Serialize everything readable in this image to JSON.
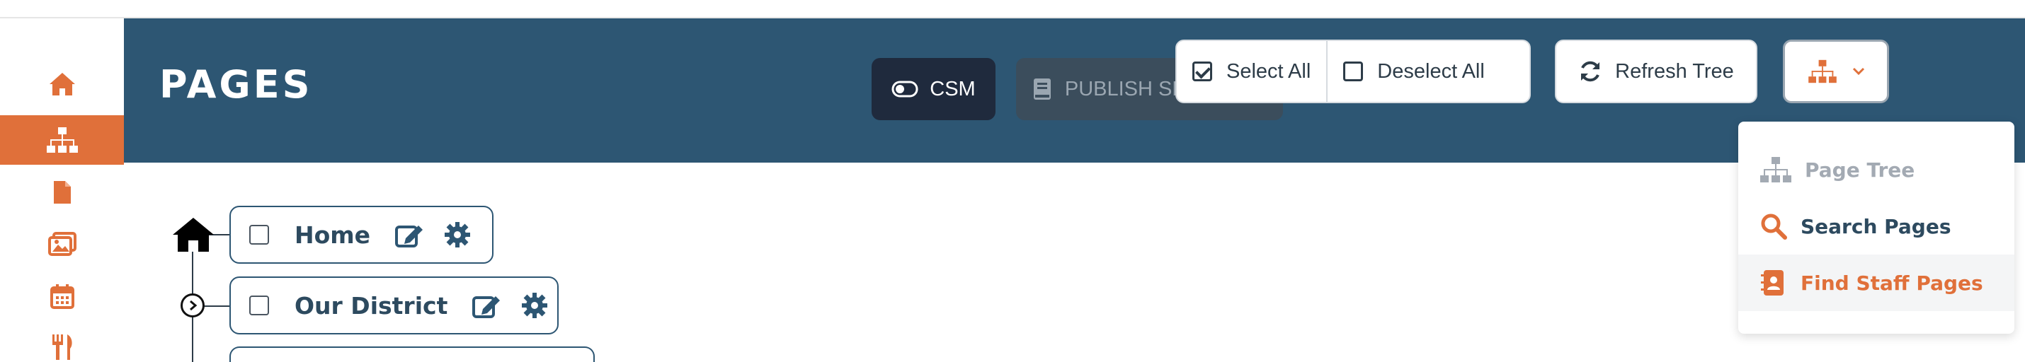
{
  "header": {
    "title": "PAGES"
  },
  "sidebar": {
    "items": [
      {
        "icon": "home-icon",
        "active": false
      },
      {
        "icon": "sitemap-icon",
        "active": true
      },
      {
        "icon": "file-icon",
        "active": false
      },
      {
        "icon": "images-icon",
        "active": false
      },
      {
        "icon": "calendar-icon",
        "active": false
      },
      {
        "icon": "utensils-icon",
        "active": false
      }
    ]
  },
  "toolbar": {
    "csm_label": "CSM",
    "publish_label": "PUBLISH SELECTED",
    "select_all_label": "Select All",
    "deselect_all_label": "Deselect All",
    "refresh_label": "Refresh Tree"
  },
  "dropdown": {
    "items": [
      {
        "label": "Page Tree",
        "icon": "sitemap-icon",
        "state": "disabled"
      },
      {
        "label": "Search Pages",
        "icon": "search-icon",
        "state": "normal"
      },
      {
        "label": "Find Staff Pages",
        "icon": "address-book-icon",
        "state": "active"
      }
    ]
  },
  "tree": {
    "nodes": [
      {
        "label": "Home",
        "checked": false
      },
      {
        "label": "Our District",
        "checked": false
      }
    ]
  },
  "colors": {
    "header_bg": "#2d5673",
    "accent": "#e0703a",
    "csm_bg": "#1f2a3d",
    "publish_bg": "#3b4d5c"
  }
}
